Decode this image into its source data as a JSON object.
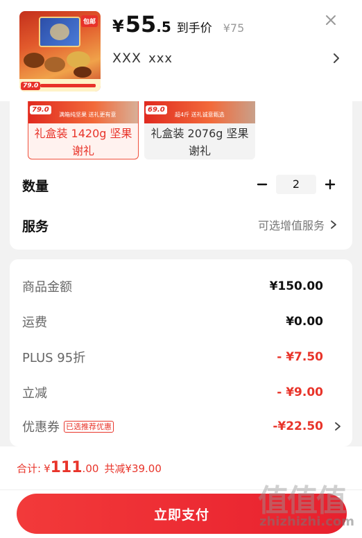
{
  "header": {
    "price_symbol": "¥",
    "price_int": "55",
    "price_dec": ".5",
    "price_label": "到手价",
    "original_price": "¥75",
    "address_name": "XXX",
    "address_detail": "xxx"
  },
  "product_image": {
    "badge_price": "79.0",
    "corner_tag": "包邮"
  },
  "options": [
    {
      "label": "礼盒装 1420g 坚果谢礼",
      "mini_price": "79.0",
      "mini_text": "满箱纯坚果 送礼更有意",
      "selected": true
    },
    {
      "label": "礼盒装 2076g 坚果谢礼",
      "mini_price": "69.0",
      "mini_text": "超4斤 送礼诚意甄选",
      "selected": false
    }
  ],
  "quantity": {
    "label": "数量",
    "value": "2"
  },
  "service": {
    "label": "服务",
    "value": "可选增值服务"
  },
  "costs": [
    {
      "label": "商品金额",
      "value": "¥150.00",
      "red": false
    },
    {
      "label": "运费",
      "value": "¥0.00",
      "red": false
    },
    {
      "label": "PLUS 95折",
      "value": "- ¥7.50",
      "red": true
    },
    {
      "label": "立减",
      "value": "- ¥9.00",
      "red": true
    },
    {
      "label": "优惠券",
      "value": "-¥22.50",
      "red": true,
      "tag": "已选推荐优惠"
    }
  ],
  "footer": {
    "total_label": "合计:",
    "total_symbol": "¥",
    "total_int": "111",
    "total_dec": ".00",
    "saved": "共减¥39.00",
    "pay_label": "立即支付"
  },
  "watermark": {
    "glyphs": "值值值",
    "text": "zhizhizhi.com"
  },
  "colors": {
    "accent": "#e8342a",
    "button": "#f02c34"
  }
}
